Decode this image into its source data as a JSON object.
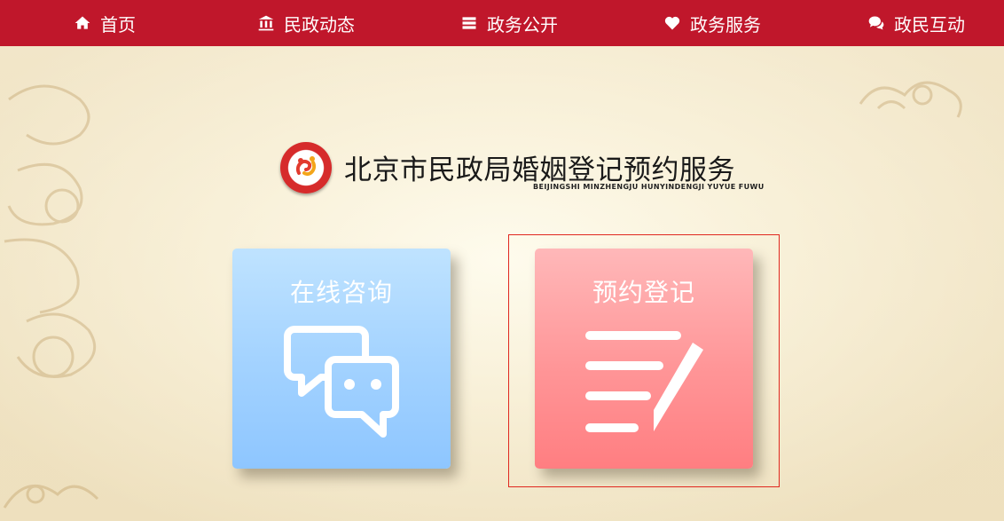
{
  "nav": {
    "items": [
      {
        "label": "首页",
        "icon": "home-icon"
      },
      {
        "label": "民政动态",
        "icon": "institution-icon"
      },
      {
        "label": "政务公开",
        "icon": "stack-icon"
      },
      {
        "label": "政务服务",
        "icon": "heart-icon"
      },
      {
        "label": "政民互动",
        "icon": "chat-icon"
      }
    ]
  },
  "header": {
    "title": "北京市民政局婚姻登记预约服务",
    "subtitle": "BEIJINGSHI MINZHENGJU HUNYINDENGJI YUYUE FUWU"
  },
  "cards": {
    "consult": {
      "label": "在线咨询",
      "icon": "chat-bubbles-icon"
    },
    "appointment": {
      "label": "预约登记",
      "icon": "edit-list-icon"
    }
  },
  "colors": {
    "nav_bg": "#c0172b",
    "consult_card": "#a4d3ff",
    "appointment_card": "#ff9597",
    "selection_border": "#e0281f"
  }
}
